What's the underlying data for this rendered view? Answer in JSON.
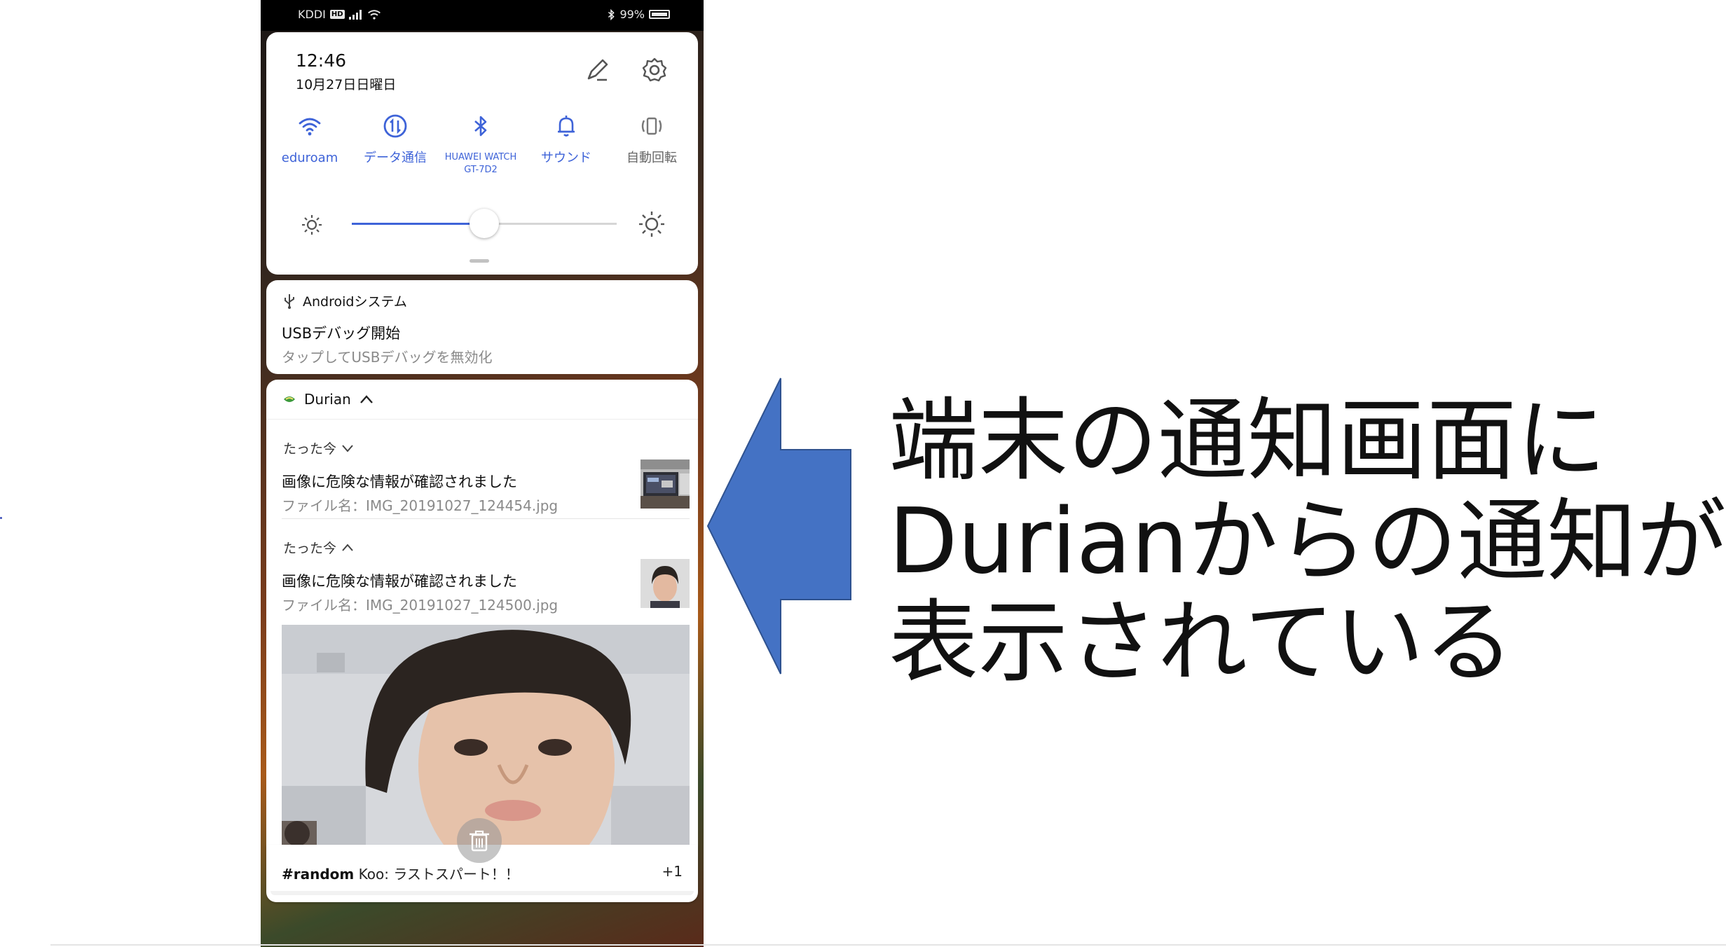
{
  "status_bar": {
    "carrier": "KDDI",
    "hd_badge": "HD",
    "battery": "99%"
  },
  "quick_settings": {
    "time": "12:46",
    "date": "10月27日日曜日",
    "tiles": [
      {
        "label": "eduroam",
        "icon": "wifi-icon"
      },
      {
        "label": "データ通信",
        "icon": "mobile-data-icon"
      },
      {
        "label": "HUAWEI WATCH GT-7D2",
        "icon": "bluetooth-icon"
      },
      {
        "label": "サウンド",
        "icon": "bell-icon"
      },
      {
        "label": "自動回転",
        "icon": "auto-rotate-icon"
      }
    ],
    "brightness_fraction": 0.5,
    "accent_color": "#3e63d8"
  },
  "notifications": {
    "android": {
      "app": "Androidシステム",
      "title": "USBデバッグ開始",
      "body": "タップしてUSBデバッグを無効化"
    },
    "durian": {
      "app": "Durian",
      "items": [
        {
          "ago": "たった今",
          "title": "画像に危険な情報が確認されました",
          "body": "ファイル名：IMG_20191027_124454.jpg"
        },
        {
          "ago": "たった今",
          "title": "画像に危険な情報が確認されました",
          "body": "ファイル名：IMG_20191027_124500.jpg"
        }
      ]
    },
    "slack": {
      "channel": "#random",
      "message": "Koo: ラストスパート！！",
      "count": "+1"
    }
  },
  "annotation": {
    "lines": [
      "端末の通知画面に",
      "Durianからの通知が",
      "表示されている"
    ],
    "arrow_color": "#4472c4"
  }
}
